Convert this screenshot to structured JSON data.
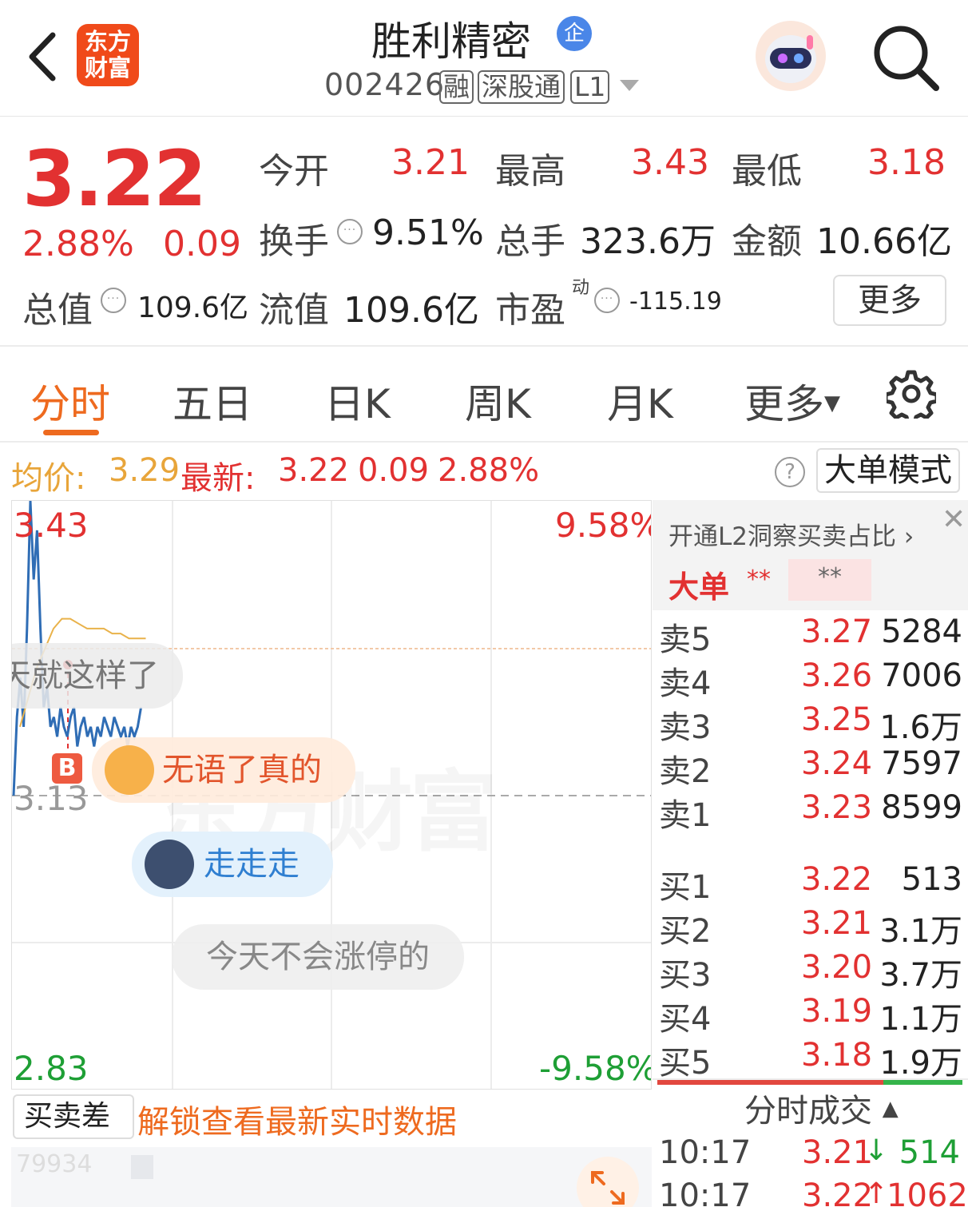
{
  "header": {
    "logo_line1": "东方",
    "logo_line2": "财富",
    "stock_name": "胜利精密",
    "badge": "企",
    "code": "002426",
    "tags": [
      "融",
      "深股通",
      "L1"
    ]
  },
  "quote": {
    "price": "3.22",
    "change_pct": "2.88%",
    "change": "0.09",
    "open_label": "今开",
    "open": "3.21",
    "high_label": "最高",
    "high": "3.43",
    "low_label": "最低",
    "low": "3.18",
    "turnover_label": "换手",
    "turnover": "9.51%",
    "volume_label": "总手",
    "volume": "323.6万",
    "amount_label": "金额",
    "amount": "10.66亿",
    "mktcap_label": "总值",
    "mktcap": "109.6亿",
    "float_label": "流值",
    "float": "109.6亿",
    "pe_label": "市盈",
    "pe_sup": "动",
    "pe": "-115.19",
    "more": "更多"
  },
  "tabs": [
    "分时",
    "五日",
    "日K",
    "周K",
    "月K",
    "更多"
  ],
  "info_line": {
    "avg_label": "均价:",
    "avg": "3.29",
    "latest_label": "最新:",
    "latest": "3.22",
    "chg": "0.09",
    "pct": "2.88%",
    "help": "?",
    "big_order_mode": "大单模式"
  },
  "chart": {
    "y_top": "3.43",
    "y_mid": "3.13",
    "y_bottom": "2.83",
    "pct_top": "9.58%",
    "pct_bottom": "-9.58%",
    "marker": "B",
    "watermark": "东方财富",
    "comments": [
      "天就这样了",
      "无语了真的",
      "走走走",
      "今天不会涨停的"
    ]
  },
  "chart_data": {
    "type": "line",
    "ylim": [
      2.83,
      3.43
    ],
    "series": [
      {
        "values": [
          3.13,
          3.21,
          3.25,
          3.2,
          3.3,
          3.43,
          3.35,
          3.4,
          3.3,
          3.22,
          3.24,
          3.2,
          3.21,
          3.19,
          3.22,
          3.2,
          3.19,
          3.21,
          3.22,
          3.18,
          3.2,
          3.21,
          3.19,
          3.2,
          3.18,
          3.2,
          3.19,
          3.21,
          3.2,
          3.19,
          3.21,
          3.2,
          3.19,
          3.2,
          3.18,
          3.2,
          3.19,
          3.2,
          3.22
        ]
      },
      {
        "values": [
          3.2,
          3.23,
          3.26,
          3.28,
          3.3,
          3.31,
          3.31,
          3.305,
          3.3,
          3.3,
          3.3,
          3.295,
          3.295,
          3.29,
          3.29,
          3.29
        ]
      }
    ]
  },
  "book": {
    "banner": "开通L2洞察买卖占比",
    "big": "大单",
    "stars1": "**",
    "stars2": "**",
    "asks": [
      {
        "label": "卖5",
        "price": "3.27",
        "vol": "5284"
      },
      {
        "label": "卖4",
        "price": "3.26",
        "vol": "7006"
      },
      {
        "label": "卖3",
        "price": "3.25",
        "vol": "1.6万"
      },
      {
        "label": "卖2",
        "price": "3.24",
        "vol": "7597"
      },
      {
        "label": "卖1",
        "price": "3.23",
        "vol": "8599"
      }
    ],
    "bids": [
      {
        "label": "买1",
        "price": "3.22",
        "vol": "513"
      },
      {
        "label": "买2",
        "price": "3.21",
        "vol": "3.1万"
      },
      {
        "label": "买3",
        "price": "3.20",
        "vol": "3.7万"
      },
      {
        "label": "买4",
        "price": "3.19",
        "vol": "1.1万"
      },
      {
        "label": "买5",
        "price": "3.18",
        "vol": "1.9万"
      }
    ],
    "ratio_red": 0.74,
    "trades_title": "分时成交",
    "trades": [
      {
        "time": "10:17",
        "price": "3.21",
        "dir": "↓",
        "vol": "514"
      },
      {
        "time": "10:17",
        "price": "3.22",
        "dir": "↑",
        "vol": "1062"
      }
    ]
  },
  "bottom": {
    "buysell": "买卖差",
    "unlock": "解锁查看最新实时数据",
    "small_num": "79934"
  }
}
